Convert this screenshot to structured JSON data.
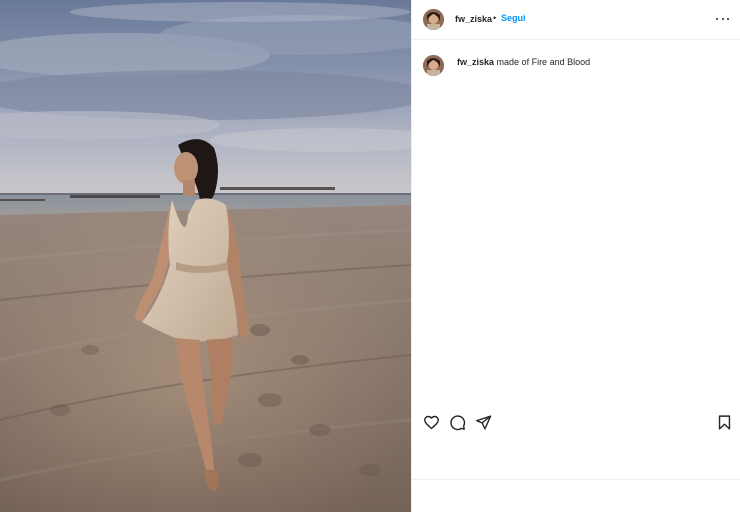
{
  "post": {
    "username": "fw_ziska",
    "separator": "•",
    "follow_label": "Segui",
    "caption": {
      "username": "fw_ziska",
      "text": "made of Fire and Blood"
    }
  },
  "icons": {
    "more": "more-options-icon",
    "like": "heart-icon",
    "comment": "comment-icon",
    "share": "send-icon",
    "save": "bookmark-icon"
  },
  "colors": {
    "follow": "#0095f6",
    "text": "#262626",
    "divider": "#efefef"
  }
}
